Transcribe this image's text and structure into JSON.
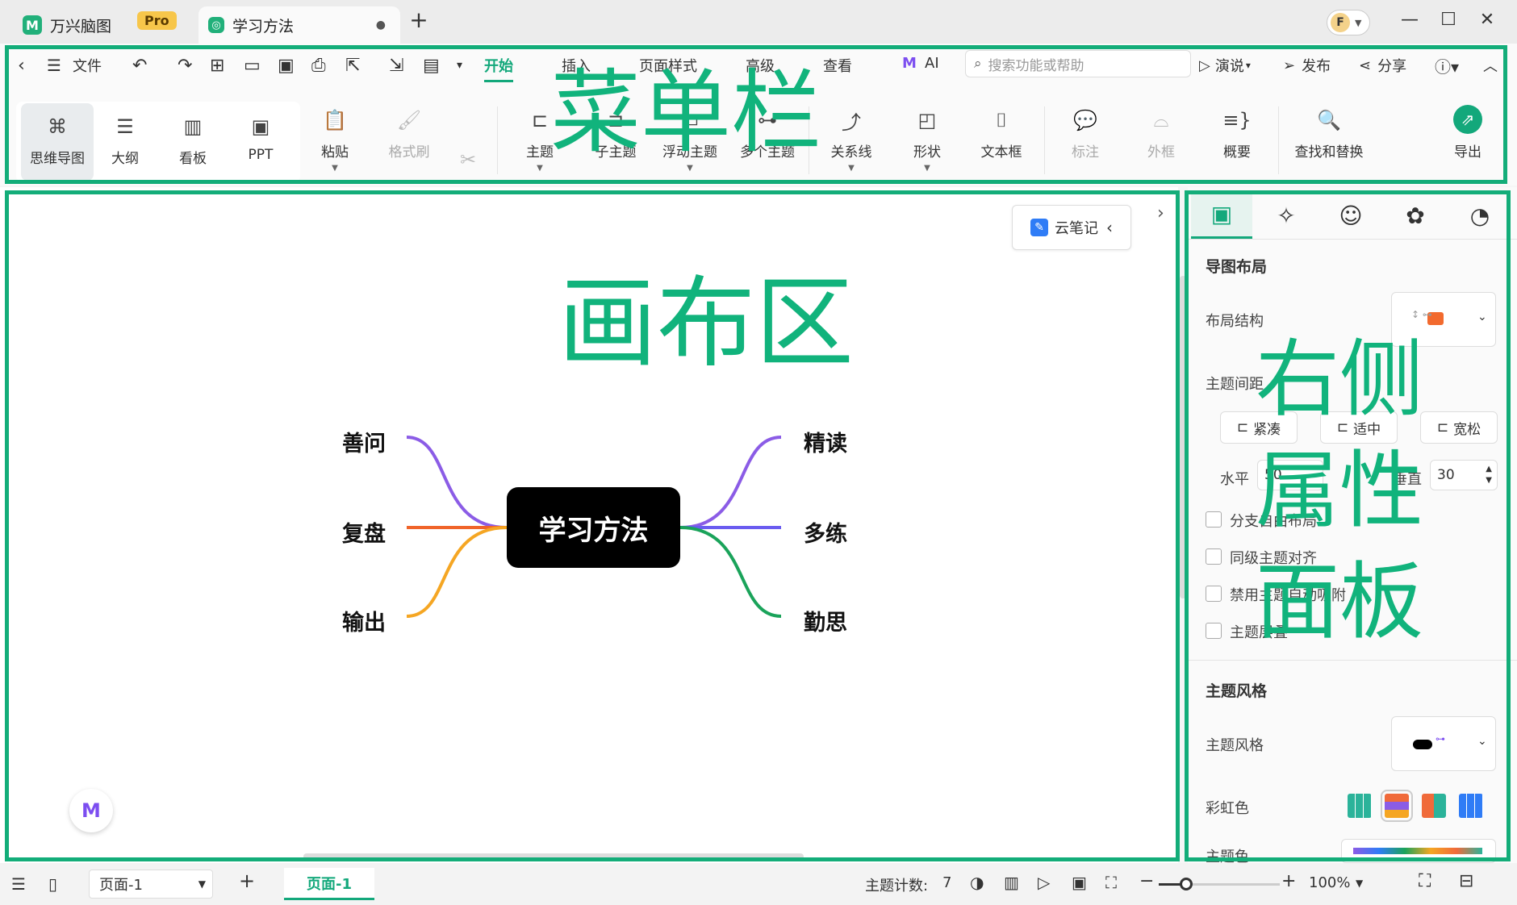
{
  "titlebar": {
    "app_name": "万兴脑图",
    "pro_badge": "Pro",
    "doc_tab": "学习方法",
    "new_tab": "+",
    "avatar_letter": "F"
  },
  "toolbar": {
    "file": "文件",
    "menus": [
      "开始",
      "插入",
      "页面样式",
      "高级",
      "查看",
      "AI"
    ],
    "search_placeholder": "搜索功能或帮助",
    "present": "演说",
    "publish": "发布",
    "share": "分享",
    "view_modes": [
      "思维导图",
      "大纲",
      "看板",
      "PPT"
    ],
    "paste": "粘贴",
    "format_painter": "格式刷",
    "topic": "主题",
    "subtopic": "子主题",
    "floating_topic": "浮动主题",
    "multiple_topics": "多个主题",
    "relationship": "关系线",
    "shape": "形状",
    "textbox": "文本框",
    "callout": "标注",
    "boundary": "外框",
    "summary": "概要",
    "find_replace": "查找和替换",
    "export": "导出"
  },
  "canvas": {
    "cloud_notes": "云笔记",
    "root": "学习方法",
    "left_nodes": [
      "善问",
      "复盘",
      "输出"
    ],
    "right_nodes": [
      "精读",
      "多练",
      "勤思"
    ]
  },
  "panel": {
    "section_layout": "导图布局",
    "layout_structure": "布局结构",
    "topic_spacing": "主题间距",
    "spacing_options": [
      "紧凑",
      "适中",
      "宽松"
    ],
    "horizontal": "水平",
    "horizontal_value": "50",
    "vertical": "垂直",
    "vertical_value": "30",
    "checkboxes": [
      "分支自由布局",
      "同级主题对齐",
      "禁用主题自动吸附",
      "主题层叠"
    ],
    "section_style": "主题风格",
    "topic_style": "主题风格",
    "rainbow": "彩虹色",
    "theme_color": "主题色"
  },
  "status": {
    "page_select": "页面-1",
    "page_tab": "页面-1",
    "topic_count_label": "主题计数:",
    "topic_count": "7",
    "zoom": "100%"
  },
  "annotations": {
    "menu_bar": "菜单栏",
    "canvas_area": "画布区",
    "right_panel": [
      "右侧",
      "属性",
      "面板"
    ]
  },
  "colors": {
    "accent": "#13a87b",
    "annotation": "#11b37c",
    "branch_purple": "#8b5ce6",
    "branch_orange": "#f0642a",
    "branch_yellow": "#f5a623",
    "branch_blue": "#6a5cf0",
    "branch_green": "#1aa35a"
  }
}
